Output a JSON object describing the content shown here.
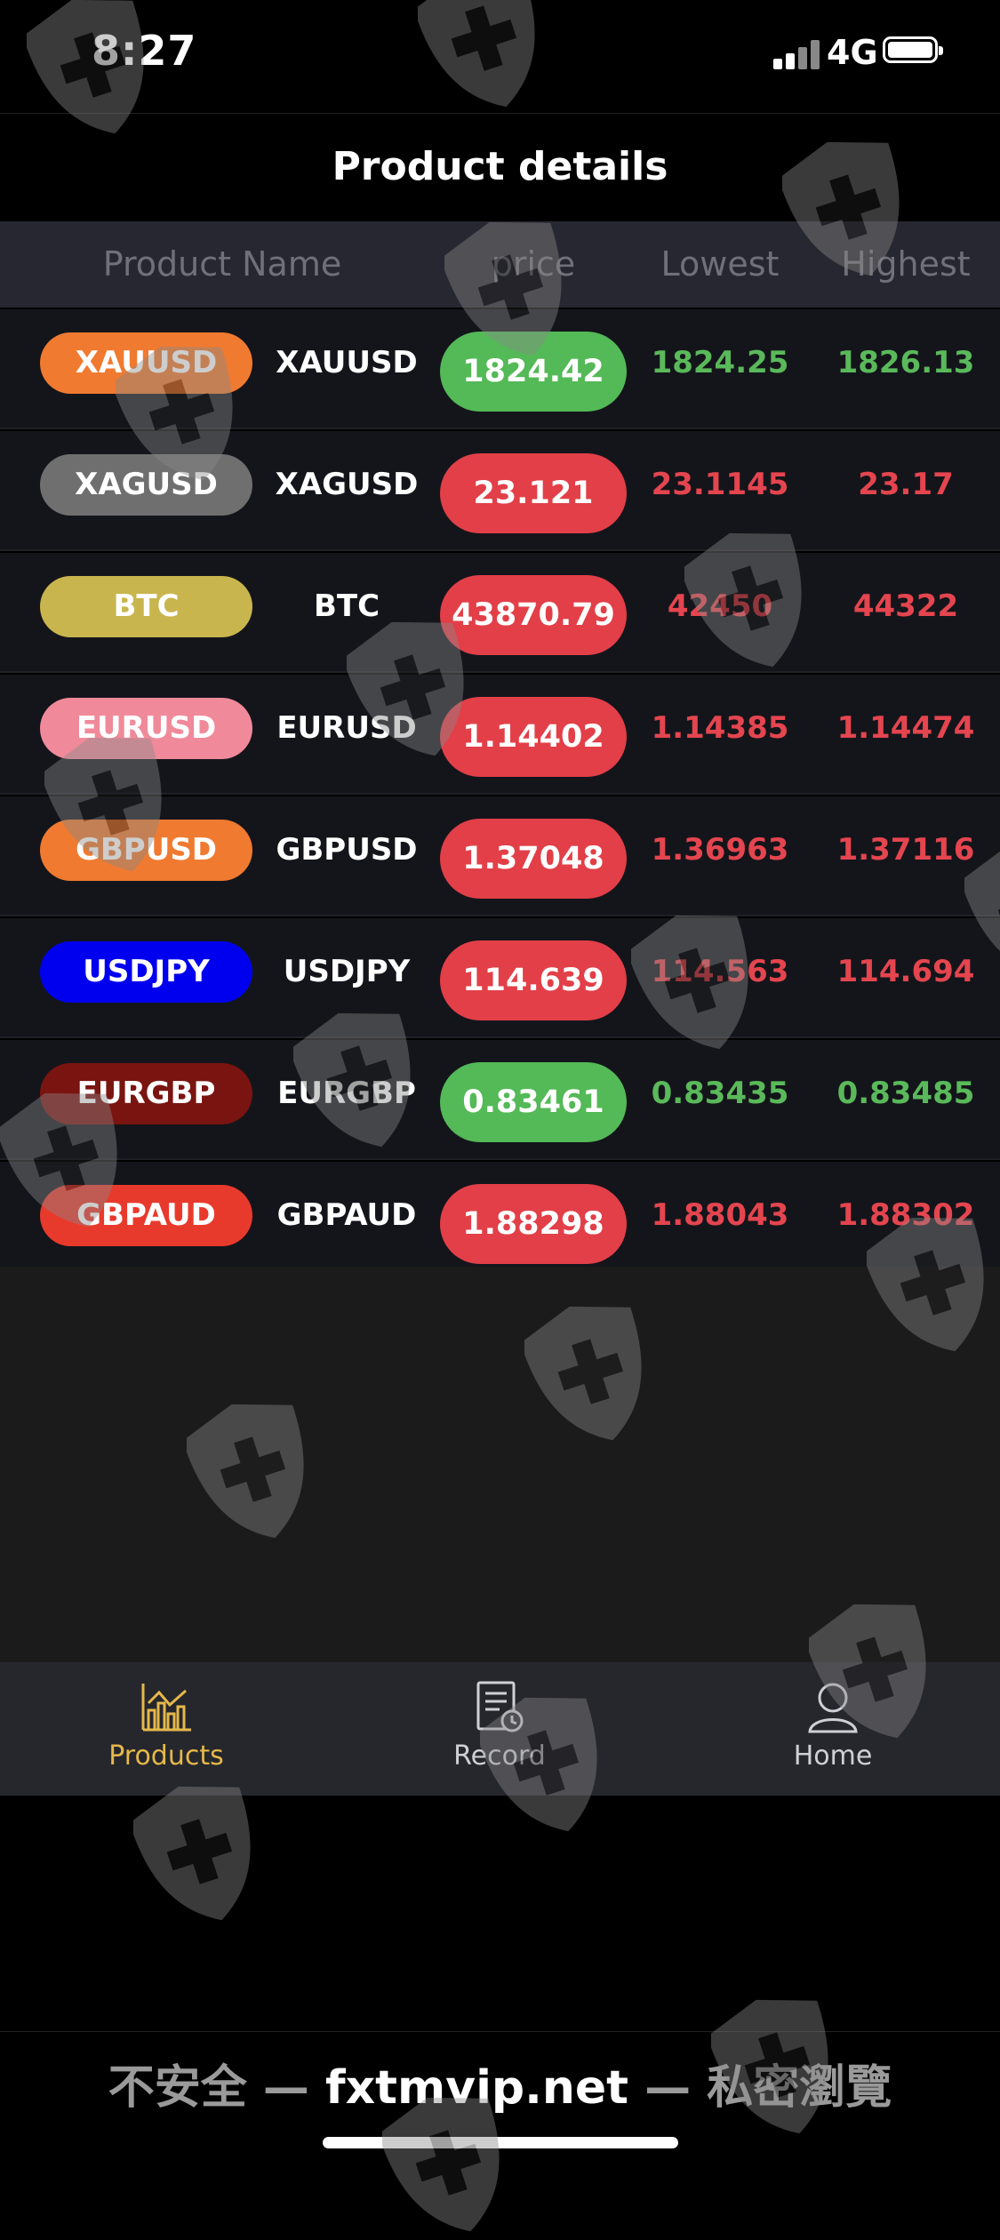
{
  "status_bar": {
    "time": "8:27",
    "network": "4G"
  },
  "header": {
    "title": "Product details"
  },
  "table": {
    "columns": [
      "Product Name",
      "price",
      "Lowest",
      "Highest"
    ],
    "rows": [
      {
        "symbol": "XAUUSD",
        "name": "XAUUSD",
        "price": "1824.42",
        "low": "1824.25",
        "high": "1826.13",
        "trend": "up",
        "pill_color": "#f07a30"
      },
      {
        "symbol": "XAGUSD",
        "name": "XAGUSD",
        "price": "23.121",
        "low": "23.1145",
        "high": "23.17",
        "trend": "down",
        "pill_color": "#6f6f70"
      },
      {
        "symbol": "BTC",
        "name": "BTC",
        "price": "43870.79",
        "low": "42450",
        "high": "44322",
        "trend": "down",
        "pill_color": "#c9b54e"
      },
      {
        "symbol": "EURUSD",
        "name": "EURUSD",
        "price": "1.14402",
        "low": "1.14385",
        "high": "1.14474",
        "trend": "down",
        "pill_color": "#f08a9a"
      },
      {
        "symbol": "GBPUSD",
        "name": "GBPUSD",
        "price": "1.37048",
        "low": "1.36963",
        "high": "1.37116",
        "trend": "down",
        "pill_color": "#f07a30"
      },
      {
        "symbol": "USDJPY",
        "name": "USDJPY",
        "price": "114.639",
        "low": "114.563",
        "high": "114.694",
        "trend": "down",
        "pill_color": "#0000ee"
      },
      {
        "symbol": "EURGBP",
        "name": "EURGBP",
        "price": "0.83461",
        "low": "0.83435",
        "high": "0.83485",
        "trend": "up",
        "pill_color": "#7a1410"
      },
      {
        "symbol": "GBPAUD",
        "name": "GBPAUD",
        "price": "1.88298",
        "low": "1.88043",
        "high": "1.88302",
        "trend": "down",
        "pill_color": "#e83a2c"
      }
    ]
  },
  "colors": {
    "up": "#5ab95a",
    "down": "#e4454f",
    "up_pill": "#54b957",
    "down_pill": "#e23f48",
    "active_tab": "#e5b84a",
    "inactive_tab": "#cfd0d6"
  },
  "tabbar": {
    "items": [
      {
        "label": "Products",
        "icon": "chart-icon",
        "active": true
      },
      {
        "label": "Record",
        "icon": "record-icon",
        "active": false
      },
      {
        "label": "Home",
        "icon": "user-icon",
        "active": false
      }
    ]
  },
  "browser_bar": {
    "prefix": "不安全 — ",
    "domain": "fxtmvip.net",
    "suffix": " — 私密瀏覽"
  }
}
